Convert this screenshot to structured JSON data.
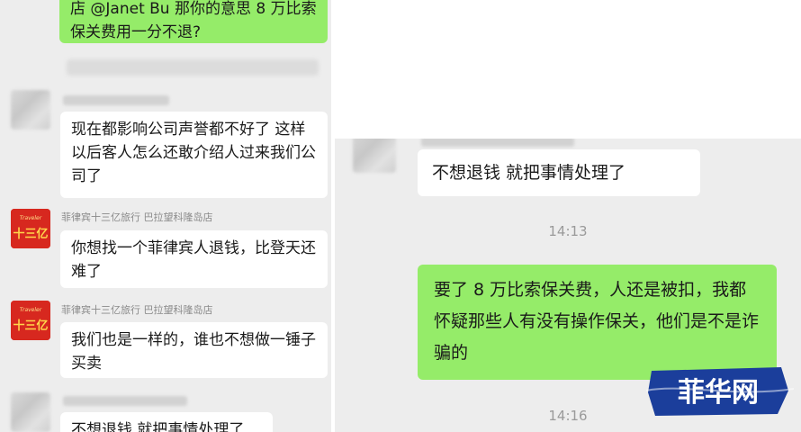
{
  "left_chat": {
    "top_message": "店 @Janet Bu 那你的意思 8 万比索保关费用一分不退?",
    "messages": [
      {
        "text": "现在都影响公司声誉都不好了 这样以后客人怎么还敢介绍人过来我们公司了"
      },
      {
        "sender": "菲律宾十三亿旅行 巴拉望科隆岛店",
        "text": "你想找一个菲律宾人退钱，比登天还难了"
      },
      {
        "sender": "菲律宾十三亿旅行 巴拉望科隆岛店",
        "text": "我们也是一样的，谁也不想做一锤子买卖"
      },
      {
        "text": "不想退钱 就把事情处理了"
      }
    ],
    "logo_text": "十三亿"
  },
  "right_chat": {
    "messages": [
      {
        "text": "不想退钱 就把事情处理了"
      },
      {
        "time": "14:13"
      },
      {
        "text": "要了 8 万比索保关费，人还是被扣，我都怀疑那些人有没有操作保关，他们是不是诈骗的"
      },
      {
        "time": "14:16"
      }
    ]
  },
  "watermark": {
    "text": "菲华网"
  },
  "colors": {
    "chat_bg": "#ededed",
    "green_bubble": "#95ec69",
    "white_bubble": "#ffffff",
    "logo_red": "#d7281f",
    "watermark_blue": "#1b3e9b"
  }
}
